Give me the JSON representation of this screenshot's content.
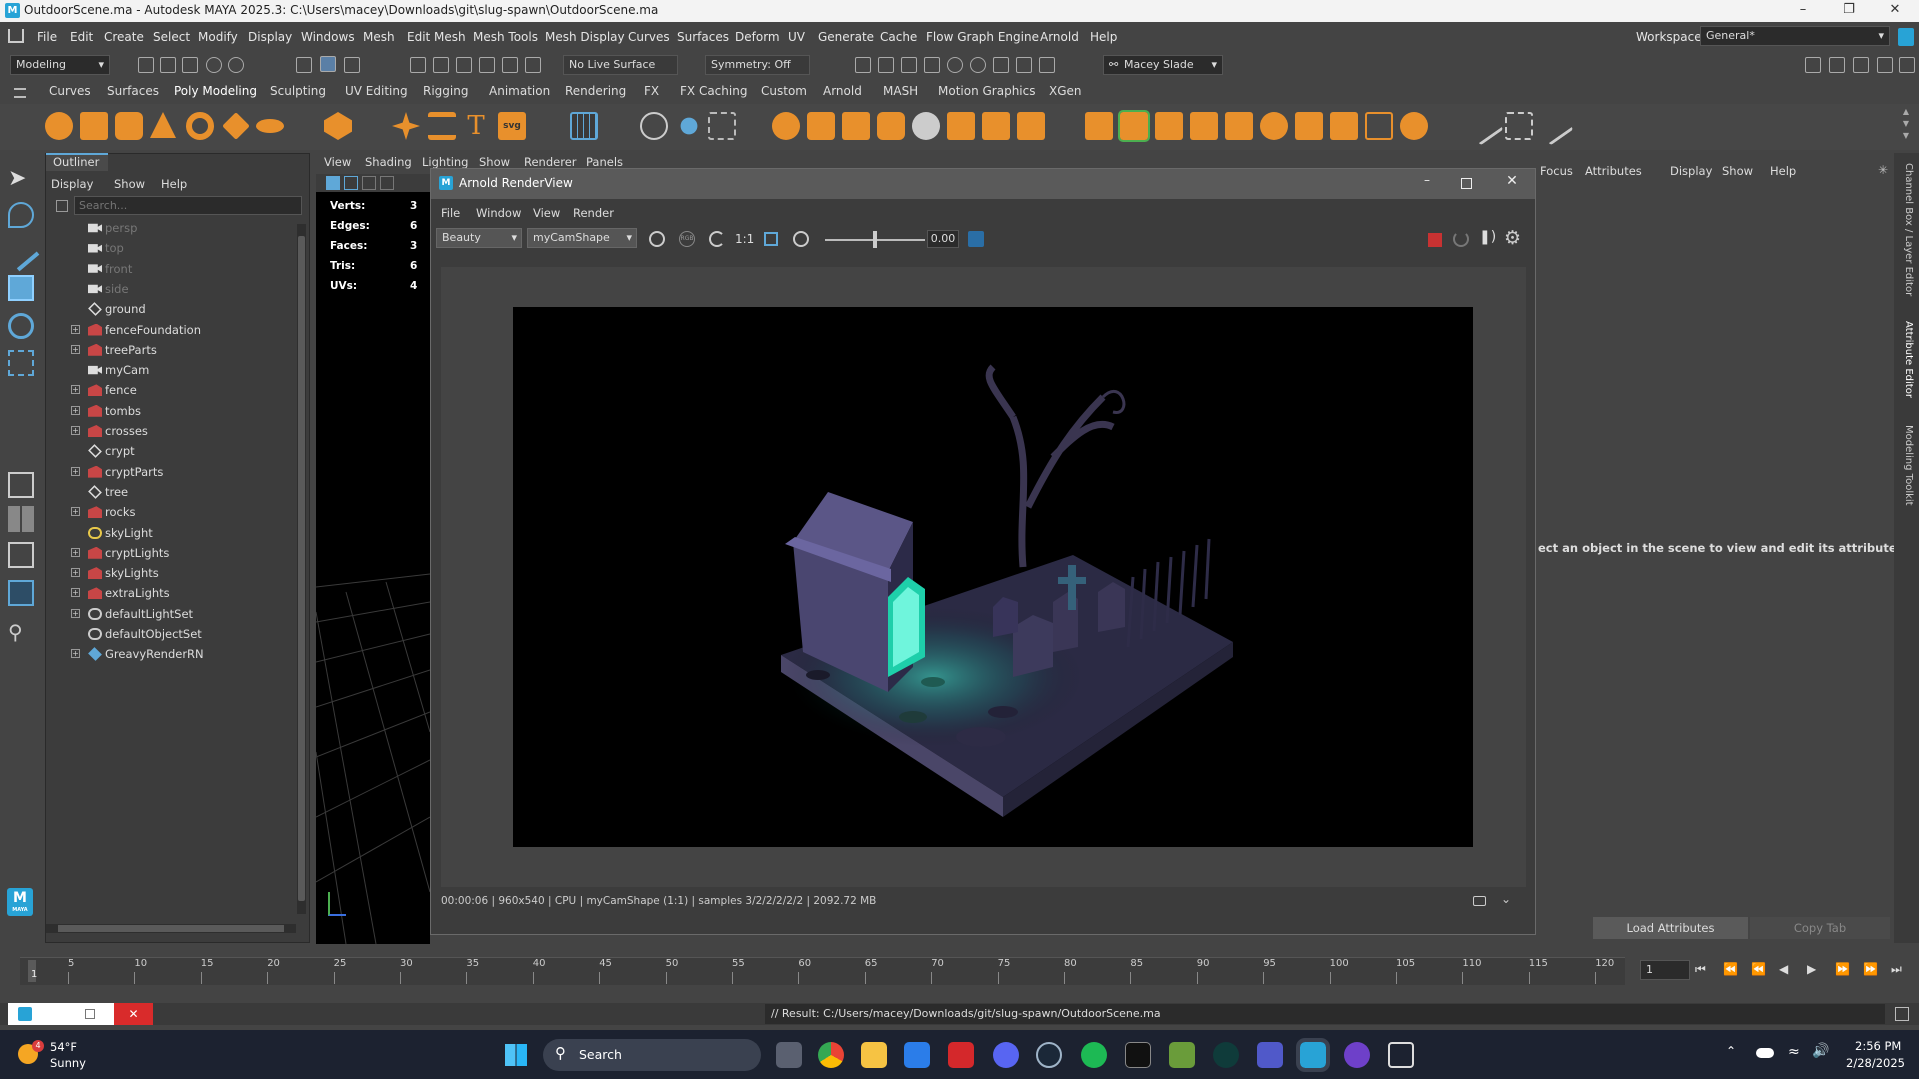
{
  "window": {
    "title": "OutdoorScene.ma - Autodesk MAYA 2025.3: C:\\Users\\macey\\Downloads\\git\\slug-spawn\\OutdoorScene.ma"
  },
  "menu": [
    "File",
    "Edit",
    "Create",
    "Select",
    "Modify",
    "Display",
    "Windows",
    "Mesh",
    "Edit Mesh",
    "Mesh Tools",
    "Mesh Display",
    "Curves",
    "Surfaces",
    "Deform",
    "UV",
    "Generate",
    "Cache",
    "Flow Graph Engine",
    "Arnold",
    "Help"
  ],
  "workspace": {
    "label": "Workspace:",
    "value": "General*"
  },
  "statusline": {
    "mode": "Modeling",
    "live_surface": "No Live Surface",
    "symmetry": "Symmetry: Off",
    "user": "Macey Slade"
  },
  "shelf_tabs": [
    "Curves",
    "Surfaces",
    "Poly Modeling",
    "Sculpting",
    "UV Editing",
    "Rigging",
    "Animation",
    "Rendering",
    "FX",
    "FX Caching",
    "Custom",
    "Arnold",
    "MASH",
    "Motion Graphics",
    "XGen"
  ],
  "outliner": {
    "title": "Outliner",
    "menu": [
      "Display",
      "Show",
      "Help"
    ],
    "search_placeholder": "Search...",
    "items": [
      {
        "label": "persp",
        "expand": false,
        "dim": true,
        "icon": "camera"
      },
      {
        "label": "top",
        "expand": false,
        "dim": true,
        "icon": "camera"
      },
      {
        "label": "front",
        "expand": false,
        "dim": true,
        "icon": "camera"
      },
      {
        "label": "side",
        "expand": false,
        "dim": true,
        "icon": "camera"
      },
      {
        "label": "ground",
        "expand": false,
        "dim": false,
        "icon": "mesh"
      },
      {
        "label": "fenceFoundation",
        "expand": true,
        "dim": false,
        "icon": "group"
      },
      {
        "label": "treeParts",
        "expand": true,
        "dim": false,
        "icon": "group"
      },
      {
        "label": "myCam",
        "expand": false,
        "dim": false,
        "icon": "camera"
      },
      {
        "label": "fence",
        "expand": true,
        "dim": false,
        "icon": "group"
      },
      {
        "label": "tombs",
        "expand": true,
        "dim": false,
        "icon": "group"
      },
      {
        "label": "crosses",
        "expand": true,
        "dim": false,
        "icon": "group"
      },
      {
        "label": "crypt",
        "expand": false,
        "dim": false,
        "icon": "mesh"
      },
      {
        "label": "cryptParts",
        "expand": true,
        "dim": false,
        "icon": "group"
      },
      {
        "label": "tree",
        "expand": false,
        "dim": false,
        "icon": "mesh"
      },
      {
        "label": "rocks",
        "expand": true,
        "dim": false,
        "icon": "group"
      },
      {
        "label": "skyLight",
        "expand": false,
        "dim": false,
        "icon": "light"
      },
      {
        "label": "cryptLights",
        "expand": true,
        "dim": false,
        "icon": "group"
      },
      {
        "label": "skyLights",
        "expand": true,
        "dim": false,
        "icon": "group"
      },
      {
        "label": "extraLights",
        "expand": true,
        "dim": false,
        "icon": "group"
      },
      {
        "label": "defaultLightSet",
        "expand": true,
        "dim": false,
        "icon": "set"
      },
      {
        "label": "defaultObjectSet",
        "expand": false,
        "dim": false,
        "icon": "set"
      },
      {
        "label": "GreavyRenderRN",
        "expand": true,
        "dim": false,
        "icon": "ref"
      }
    ]
  },
  "viewport": {
    "menu": [
      "View",
      "Shading",
      "Lighting",
      "Show",
      "Renderer",
      "Panels"
    ],
    "hud": [
      {
        "label": "Verts:",
        "value": "3"
      },
      {
        "label": "Edges:",
        "value": "6"
      },
      {
        "label": "Faces:",
        "value": "3"
      },
      {
        "label": "Tris:",
        "value": "6"
      },
      {
        "label": "UVs:",
        "value": "4"
      }
    ]
  },
  "renderview": {
    "title": "Arnold RenderView",
    "menu": [
      "File",
      "Window",
      "View",
      "Render"
    ],
    "aov": "Beauty",
    "camera": "myCamShape",
    "ratio": "1:1",
    "exposure": "0.00",
    "status": "00:00:06 | 960x540 | CPU | myCamShape (1:1) | samples 3/2/2/2/2/2 | 2092.72 MB"
  },
  "rightpanel": {
    "menu": [
      "Focus",
      "Attributes",
      "Display",
      "Show",
      "Help"
    ],
    "message": "ect an object in the scene to view and edit its attributes",
    "load_button": "Load Attributes",
    "copy_button": "Copy Tab",
    "side_tabs": [
      "Channel Box / Layer Editor",
      "Attribute Editor",
      "Modeling Toolkit"
    ]
  },
  "timeline": {
    "ticks": [
      "5",
      "10",
      "15",
      "20",
      "25",
      "30",
      "35",
      "40",
      "45",
      "50",
      "55",
      "60",
      "65",
      "70",
      "75",
      "80",
      "85",
      "90",
      "95",
      "100",
      "105",
      "110",
      "115",
      "120"
    ],
    "start": "1",
    "current_frame": "1"
  },
  "cmdline": {
    "result": "// Result: C:/Users/macey/Downloads/git/slug-spawn/OutdoorScene.ma"
  },
  "taskbar": {
    "weather_temp": "54°F",
    "weather_desc": "Sunny",
    "weather_badge": "4",
    "search_label": "Search",
    "time": "2:56 PM",
    "date": "2/28/2025",
    "maya_badge": "MAYA"
  },
  "colors": {
    "maya_accent": "#28a3d6",
    "shelf_orange": "#e8902c",
    "stop_red": "#c83232",
    "close_red": "#d92b2b"
  }
}
